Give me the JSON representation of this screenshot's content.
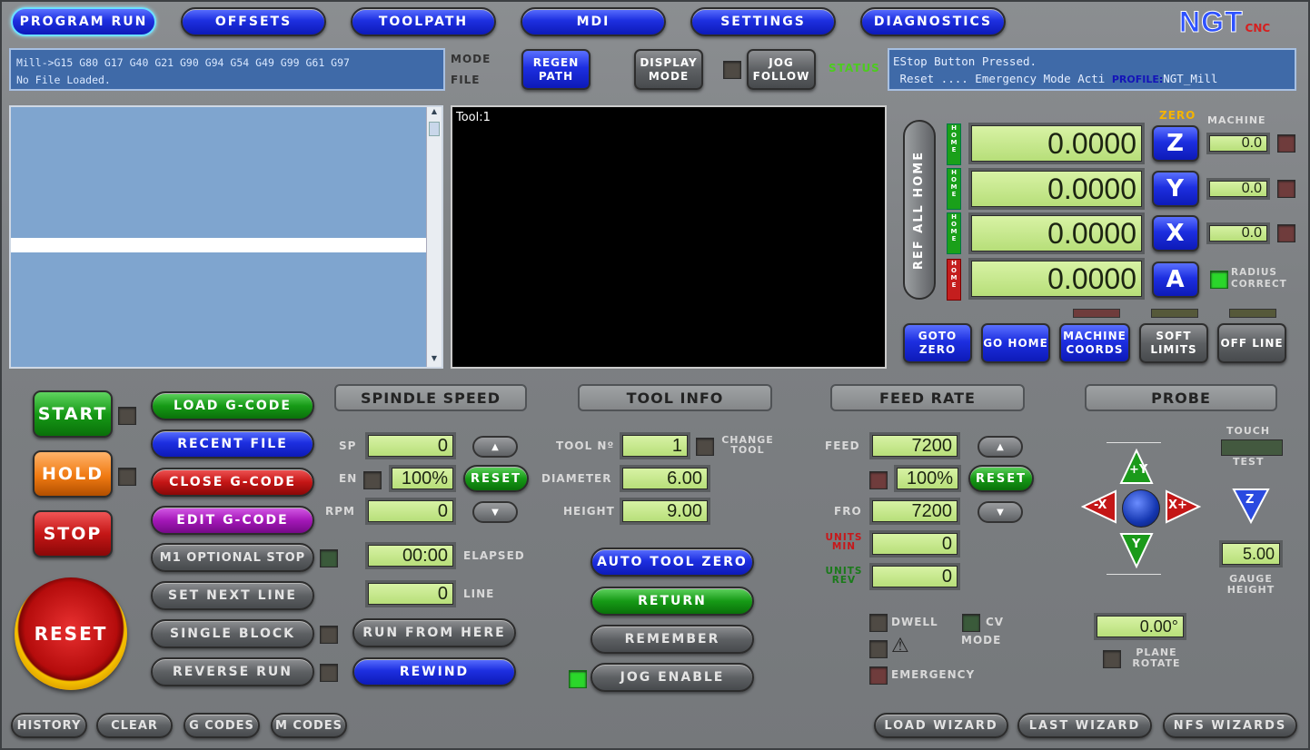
{
  "tabs": [
    "PROGRAM RUN",
    "OFFSETS",
    "TOOLPATH",
    "MDI",
    "SETTINGS",
    "DIAGNOSTICS"
  ],
  "logo": {
    "main": "NGT",
    "sub": "CNC"
  },
  "gcode_status": {
    "line1": "Mill->G15  G80 G17 G40 G21 G90 G94 G54 G49 G99 G61 G97",
    "line2": "No File Loaded."
  },
  "mode_label": "MODE",
  "file_label": "FILE",
  "regen_path": "REGEN PATH",
  "display_mode": "DISPLAY MODE",
  "jog_follow": "JOG FOLLOW",
  "status": {
    "label": "STATUS",
    "line1": "EStop Button Pressed.",
    "line2": " Reset .... Emergency Mode Acti",
    "profile_label": "PROFILE:",
    "profile_value": "NGT_Mill"
  },
  "toolpath": {
    "tool": "Tool:1"
  },
  "dro": {
    "ref_all_home": "REF ALL HOME",
    "zero_label": "ZERO",
    "machine_label": "MACHINE",
    "home_label": "HOME",
    "axes": [
      {
        "name": "Z",
        "value": "0.0000",
        "machine": "0.0"
      },
      {
        "name": "Y",
        "value": "0.0000",
        "machine": "0.0"
      },
      {
        "name": "X",
        "value": "0.0000",
        "machine": "0.0"
      },
      {
        "name": "A",
        "value": "0.0000",
        "machine": ""
      }
    ],
    "radius_correct": "RADIUS CORRECT"
  },
  "dro_buttons": [
    "GOTO ZERO",
    "GO HOME",
    "MACHINE COORDS",
    "SOFT LIMITS",
    "OFF LINE"
  ],
  "cycle": {
    "start": "START",
    "hold": "HOLD",
    "stop": "STOP",
    "reset": "RESET"
  },
  "file_buttons": [
    "LOAD G-CODE",
    "RECENT FILE",
    "CLOSE G-CODE",
    "EDIT G-CODE",
    "M1 OPTIONAL STOP",
    "SET NEXT LINE",
    "SINGLE BLOCK",
    "REVERSE RUN"
  ],
  "run_from_here": "RUN FROM HERE",
  "rewind": "REWIND",
  "spindle": {
    "title": "SPINDLE SPEED",
    "sp_label": "SP",
    "sp": "0",
    "en_label": "EN",
    "en": "100%",
    "reset": "RESET",
    "rpm_label": "RPM",
    "rpm": "0"
  },
  "elapsed": {
    "value": "00:00",
    "label": "ELAPSED"
  },
  "line": {
    "value": "0",
    "label": "LINE"
  },
  "tool_info": {
    "title": "TOOL INFO",
    "tool_no_label": "TOOL Nº",
    "tool_no": "1",
    "change_tool": "CHANGE TOOL",
    "diameter_label": "DIAMETER",
    "diameter": "6.00",
    "height_label": "HEIGHT",
    "height": "9.00",
    "auto_tool_zero": "AUTO TOOL ZERO",
    "return": "RETURN",
    "remember": "REMEMBER",
    "jog_enable": "JOG ENABLE"
  },
  "feed": {
    "title": "FEED RATE",
    "feed_label": "FEED",
    "feed": "7200",
    "ovr": "100%",
    "reset": "RESET",
    "fro_label": "FRO",
    "fro": "7200",
    "units_min_label": "UNITS MIN",
    "units_min": "0",
    "units_rev_label": "UNITS REV",
    "units_rev": "0",
    "dwell": "DWELL",
    "cv": "CV",
    "cv_mode": "MODE",
    "emergency": "EMERGENCY"
  },
  "probe": {
    "title": "PROBE",
    "touch": "TOUCH",
    "test": "TEST",
    "minus_x": "-X",
    "plus_x": "X+",
    "plus_y": "+Y",
    "minus_y": "Y",
    "z": "Z",
    "gauge": "5.00",
    "gauge_label": "GAUGE HEIGHT",
    "rotate": "0.00°",
    "plane_rotate": "PLANE ROTATE"
  },
  "bottom": {
    "history": "HISTORY",
    "clear": "CLEAR",
    "gcodes": "G CODES",
    "mcodes": "M CODES",
    "load_wizard": "LOAD WIZARD",
    "last_wizard": "LAST WIZARD",
    "nfs_wizards": "NFS WIZARDS"
  }
}
